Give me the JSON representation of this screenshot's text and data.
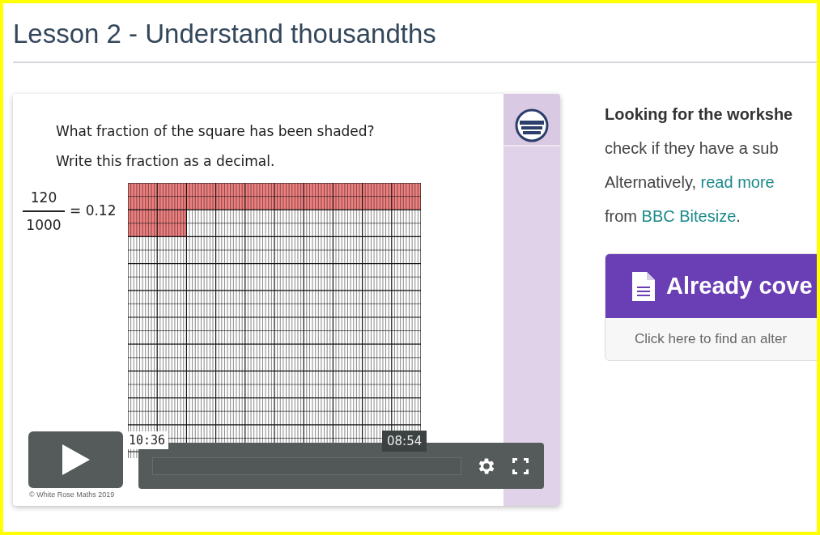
{
  "page": {
    "title": "Lesson 2 - Understand thousandths"
  },
  "video": {
    "question_lines": [
      "What fraction of the square has been shaded?",
      "Write this fraction as a decimal."
    ],
    "fraction": {
      "numerator": "120",
      "denominator": "1000",
      "result": "= 0.12"
    },
    "hover_time": "10:36",
    "duration": "08:54",
    "copyright": "© White Rose Maths 2019"
  },
  "info": {
    "lines": [
      {
        "parts": [
          {
            "text": "Looking for the workshe",
            "kind": "bold"
          }
        ]
      },
      {
        "parts": [
          {
            "text": "check if they have a sub",
            "kind": "plain"
          }
        ]
      },
      {
        "parts": [
          {
            "text": "Alternatively, ",
            "kind": "plain"
          },
          {
            "text": "read more",
            "kind": "link"
          }
        ]
      },
      {
        "parts": [
          {
            "text": "from ",
            "kind": "plain"
          },
          {
            "text": "BBC Bitesize",
            "kind": "link"
          },
          {
            "text": ".",
            "kind": "plain"
          }
        ]
      }
    ]
  },
  "card": {
    "title": "Already cove",
    "subtitle": "Click here to find an alter"
  }
}
